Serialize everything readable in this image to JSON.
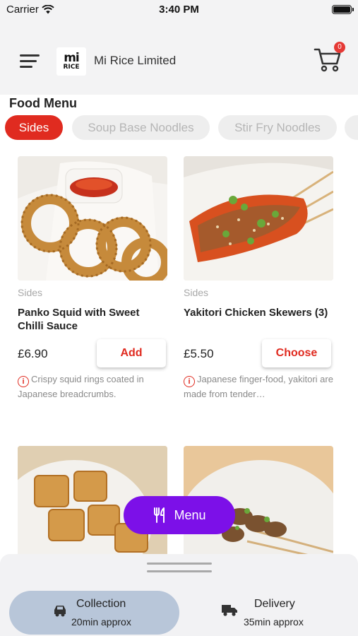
{
  "status_bar": {
    "carrier": "Carrier",
    "time": "3:40 PM"
  },
  "header": {
    "logo_line1": "mi",
    "logo_line2": "RICE",
    "store_name": "Mi Rice Limited",
    "cart_count": "0"
  },
  "menu_title": "Food Menu",
  "categories": [
    {
      "label": "Sides",
      "active": true
    },
    {
      "label": "Soup Base Noodles",
      "active": false
    },
    {
      "label": "Stir Fry Noodles",
      "active": false
    }
  ],
  "products": [
    {
      "category": "Sides",
      "name": "Panko Squid with Sweet Chilli Sauce",
      "price": "£6.90",
      "button": "Add",
      "description": "Crispy squid rings coated in Japanese breadcrumbs."
    },
    {
      "category": "Sides",
      "name": "Yakitori Chicken Skewers (3)",
      "price": "£5.50",
      "button": "Choose",
      "description": "Japanese finger-food, yakitori are made from tender…"
    }
  ],
  "menu_button": {
    "label": "Menu",
    "icon": "fork-knife-icon"
  },
  "order_modes": [
    {
      "title": "Collection",
      "subtitle": "20min approx",
      "icon": "collection-car-icon",
      "active": true
    },
    {
      "title": "Delivery",
      "subtitle": "35min approx",
      "icon": "delivery-truck-icon",
      "active": false
    }
  ],
  "colors": {
    "accent": "#e02b20",
    "menu_button": "#7c10e8",
    "selected_mode": "#b8c6d9",
    "badge": "#e53935"
  }
}
